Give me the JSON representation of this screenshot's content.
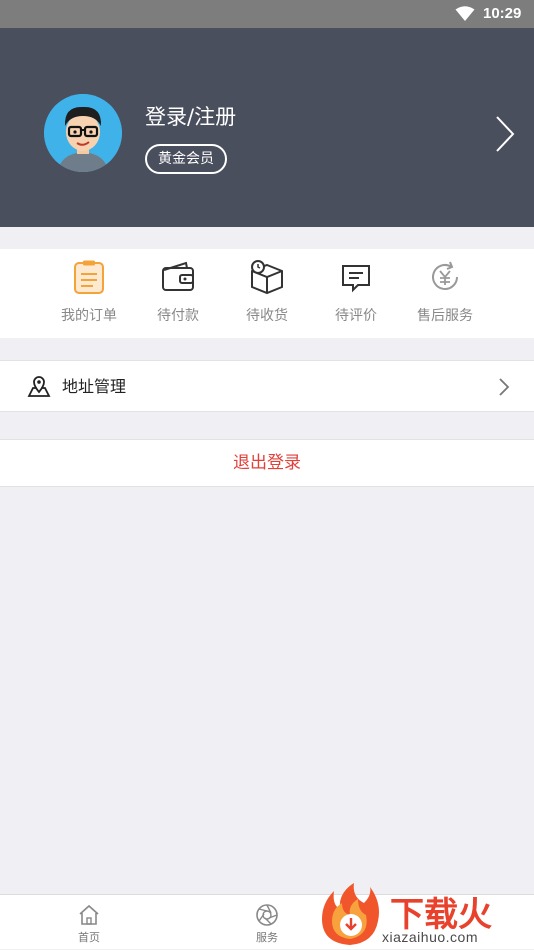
{
  "status_bar": {
    "time": "10:29",
    "wifi_icon": "wifi-icon"
  },
  "profile": {
    "login_text": "登录/注册",
    "member_badge": "黄金会员",
    "avatar_icon": "avatar-cartoon-icon",
    "chevron_icon": "chevron-right-icon"
  },
  "orders": {
    "items": [
      {
        "label": "我的订单",
        "icon": "clipboard-icon",
        "color": "#f2a33a"
      },
      {
        "label": "待付款",
        "icon": "wallet-icon",
        "color": "#333333"
      },
      {
        "label": "待收货",
        "icon": "package-clock-icon",
        "color": "#333333"
      },
      {
        "label": "待评价",
        "icon": "comment-icon",
        "color": "#333333"
      },
      {
        "label": "售后服务",
        "icon": "refund-yen-icon",
        "color": "#999999"
      }
    ]
  },
  "address": {
    "label": "地址管理",
    "icon": "location-pin-icon"
  },
  "logout": {
    "label": "退出登录",
    "color": "#e0413a"
  },
  "tabbar": {
    "tabs": [
      {
        "label": "首页",
        "icon": "home-icon"
      },
      {
        "label": "服务",
        "icon": "aperture-icon"
      }
    ]
  },
  "watermark": {
    "brand": "下载火",
    "url": "xiazaihuo.com"
  }
}
